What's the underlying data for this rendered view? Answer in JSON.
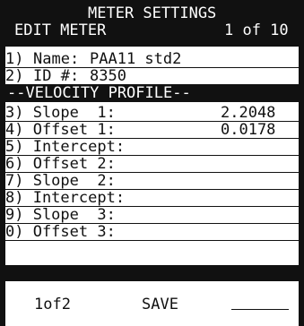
{
  "header": {
    "title": "METER SETTINGS",
    "mode": "EDIT METER",
    "page_indicator": "1 of 10"
  },
  "fields": [
    {
      "key": "1)",
      "label": "Name:",
      "value": "PAA11 std2"
    },
    {
      "key": "2)",
      "label": "ID #:",
      "value": "8350"
    }
  ],
  "section_title": "--VELOCITY PROFILE--",
  "profile": [
    {
      "text": "3) Slope  1:",
      "value": "2.2048"
    },
    {
      "text": "4) Offset 1:",
      "value": "0.0178"
    },
    {
      "text": "5) Intercept:",
      "value": ""
    },
    {
      "text": "6) Offset 2:",
      "value": ""
    },
    {
      "text": "7) Slope  2:",
      "value": ""
    },
    {
      "text": "8) Intercept:",
      "value": ""
    },
    {
      "text": "9) Slope  3:",
      "value": ""
    },
    {
      "text": "0) Offset 3:",
      "value": ""
    }
  ],
  "softkeys": {
    "left": "1of2",
    "middle": "SAVE",
    "right": ""
  }
}
